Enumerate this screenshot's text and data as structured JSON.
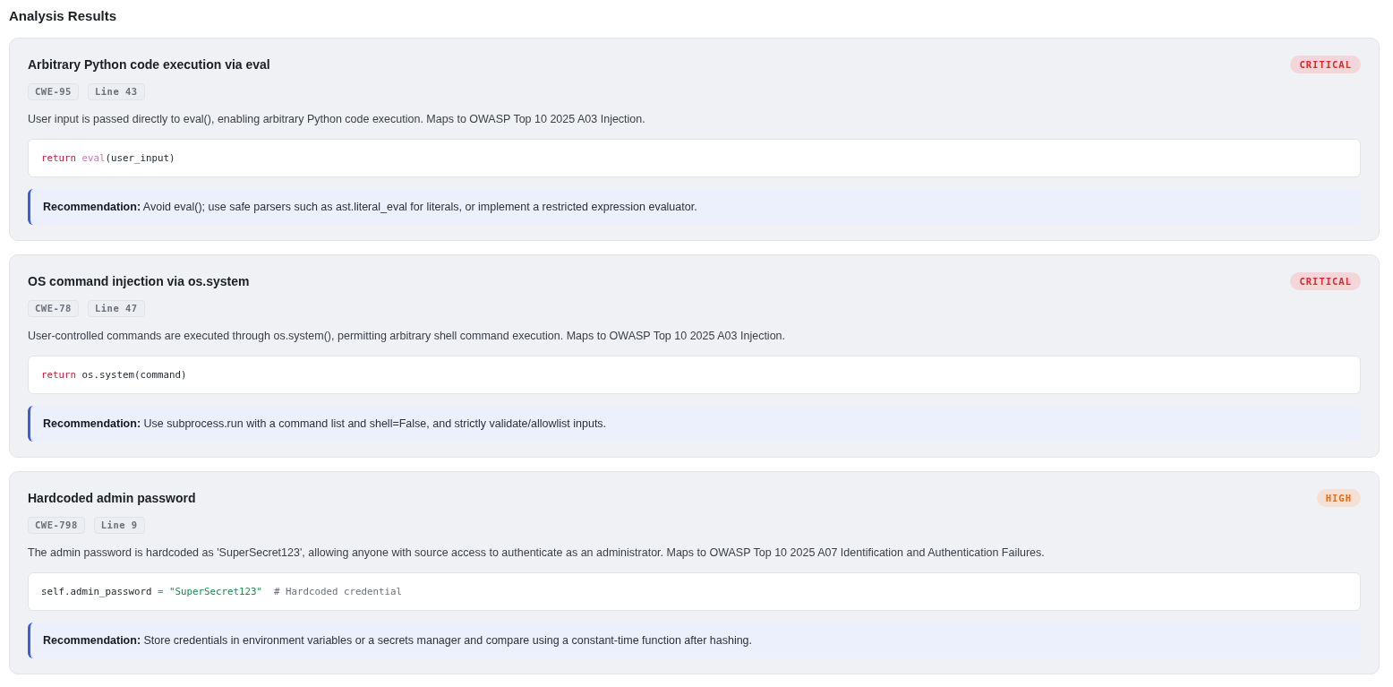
{
  "heading": "Analysis Results",
  "findings": [
    {
      "title": "Arbitrary Python code execution via eval",
      "severity": {
        "label": "CRITICAL",
        "kind": "critical"
      },
      "cwe": "CWE-95",
      "line": "Line 43",
      "description": "User input is passed directly to eval(), enabling arbitrary Python code execution. Maps to OWASP Top 10 2025 A03 Injection.",
      "code": [
        {
          "kind": "keyword",
          "text": "return "
        },
        {
          "kind": "builtin",
          "text": "eval"
        },
        {
          "kind": "plain",
          "text": "(user_input)"
        }
      ],
      "recommendation": "**Recommendation:** Avoid eval(); use safe parsers such as ast.literal_eval for literals, or implement a restricted expression evaluator."
    },
    {
      "title": "OS command injection via os.system",
      "severity": {
        "label": "CRITICAL",
        "kind": "critical"
      },
      "cwe": "CWE-78",
      "line": "Line 47",
      "description": "User-controlled commands are executed through os.system(), permitting arbitrary shell command execution. Maps to OWASP Top 10 2025 A03 Injection.",
      "code": [
        {
          "kind": "keyword",
          "text": "return"
        },
        {
          "kind": "plain",
          "text": " os.system(command)"
        }
      ],
      "recommendation": "**Recommendation:** Use subprocess.run with a command list and shell=False, and strictly validate/allowlist inputs."
    },
    {
      "title": "Hardcoded admin password",
      "severity": {
        "label": "HIGH",
        "kind": "high"
      },
      "cwe": "CWE-798",
      "line": "Line 9",
      "description": "The admin password is hardcoded as 'SuperSecret123', allowing anyone with source access to authenticate as an administrator. Maps to OWASP Top 10 2025 A07 Identification and Authentication Failures.",
      "code": [
        {
          "kind": "plain",
          "text": "self.admin_password "
        },
        {
          "kind": "operator",
          "text": "= "
        },
        {
          "kind": "string",
          "text": "\"SuperSecret123\"  "
        },
        {
          "kind": "comment",
          "text": "# Hardcoded credential"
        }
      ],
      "recommendation": "**Recommendation:** Store credentials in environment variables or a secrets manager and compare using a constant-time function after hashing."
    }
  ]
}
